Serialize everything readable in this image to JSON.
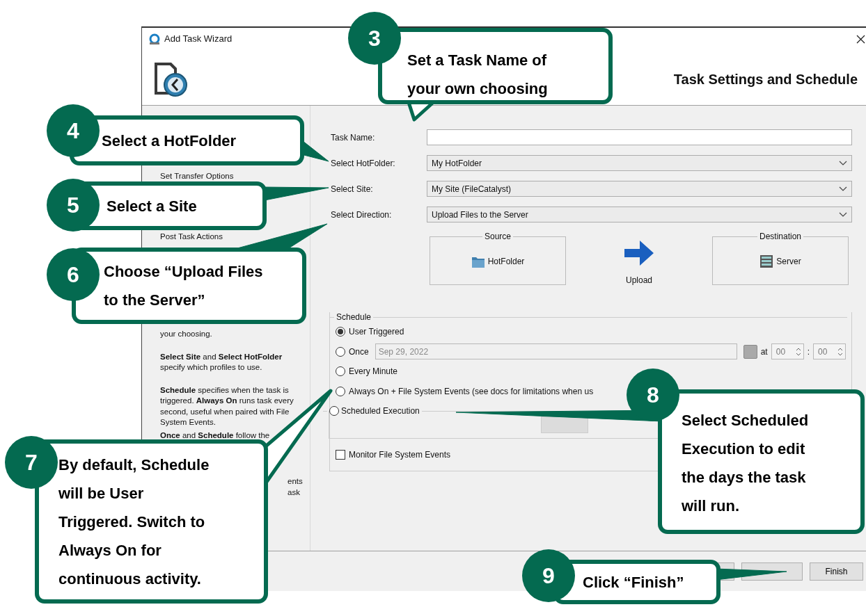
{
  "window": {
    "title": "Add Task Wizard"
  },
  "header": {
    "title": "Task Settings and Schedule"
  },
  "sidebar": {
    "items": [
      {
        "label": "Set Transfer Options"
      },
      {
        "label": "Post Task Actions"
      }
    ],
    "help": [
      "your choosing.",
      "**Select Site** and **Select HotFolder** specify which profiles to use.",
      "**Schedule** specifies when the task is triggered. **Always On** runs task every second, useful when paired with File System Events.",
      "**Once** and **Schedule** follow the",
      "ents",
      "ask"
    ]
  },
  "form": {
    "fields": [
      {
        "label": "Task Name:",
        "kind": "text"
      },
      {
        "label": "Select HotFolder:",
        "kind": "select",
        "value": "My HotFolder"
      },
      {
        "label": "Select Site:",
        "kind": "select",
        "value": "My Site (FileCatalyst)"
      },
      {
        "label": "Select Direction:",
        "kind": "select",
        "value": "Upload Files to the Server"
      }
    ]
  },
  "transfer": {
    "source": {
      "legend": "Source",
      "label": "HotFolder"
    },
    "action": "Upload",
    "destination": {
      "legend": "Destination",
      "label": "Server"
    }
  },
  "schedule": {
    "legend": "Schedule",
    "options": [
      {
        "label": "User Triggered",
        "kind": "plain",
        "selected": true
      },
      {
        "label": "Once",
        "kind": "datetime",
        "selected": false,
        "date": "Sep 29, 2022",
        "at": "at",
        "hour": "00",
        "separator": ":",
        "minute": "00"
      },
      {
        "label": "Every Minute",
        "kind": "plain",
        "selected": false
      },
      {
        "label": "Always On + File System Events (see docs for limitations when us",
        "kind": "plain",
        "selected": false
      },
      {
        "label": "Scheduled Execution",
        "kind": "group",
        "selected": false
      }
    ]
  },
  "monitor": {
    "label": "Monitor File System Events",
    "checked": false
  },
  "footer_buttons": [
    {
      "kind": "covered"
    },
    {
      "kind": "covered"
    },
    {
      "kind": "text",
      "label": "Finish"
    }
  ],
  "callouts": [
    {
      "number": "3",
      "text": "Set a Task Name of\nyour own choosing"
    },
    {
      "number": "4",
      "text": "Select a HotFolder"
    },
    {
      "number": "5",
      "text": "Select a Site"
    },
    {
      "number": "6",
      "text": "Choose “Upload Files\nto the Server”"
    },
    {
      "number": "7",
      "text": "By default, Schedule\nwill be User\nTriggered. Switch to\nAlways On for\ncontinuous activity."
    },
    {
      "number": "8",
      "text": "Select Scheduled\nExecution to edit\nthe days the task\nwill run."
    },
    {
      "number": "9",
      "text": "Click “Finish”"
    }
  ]
}
